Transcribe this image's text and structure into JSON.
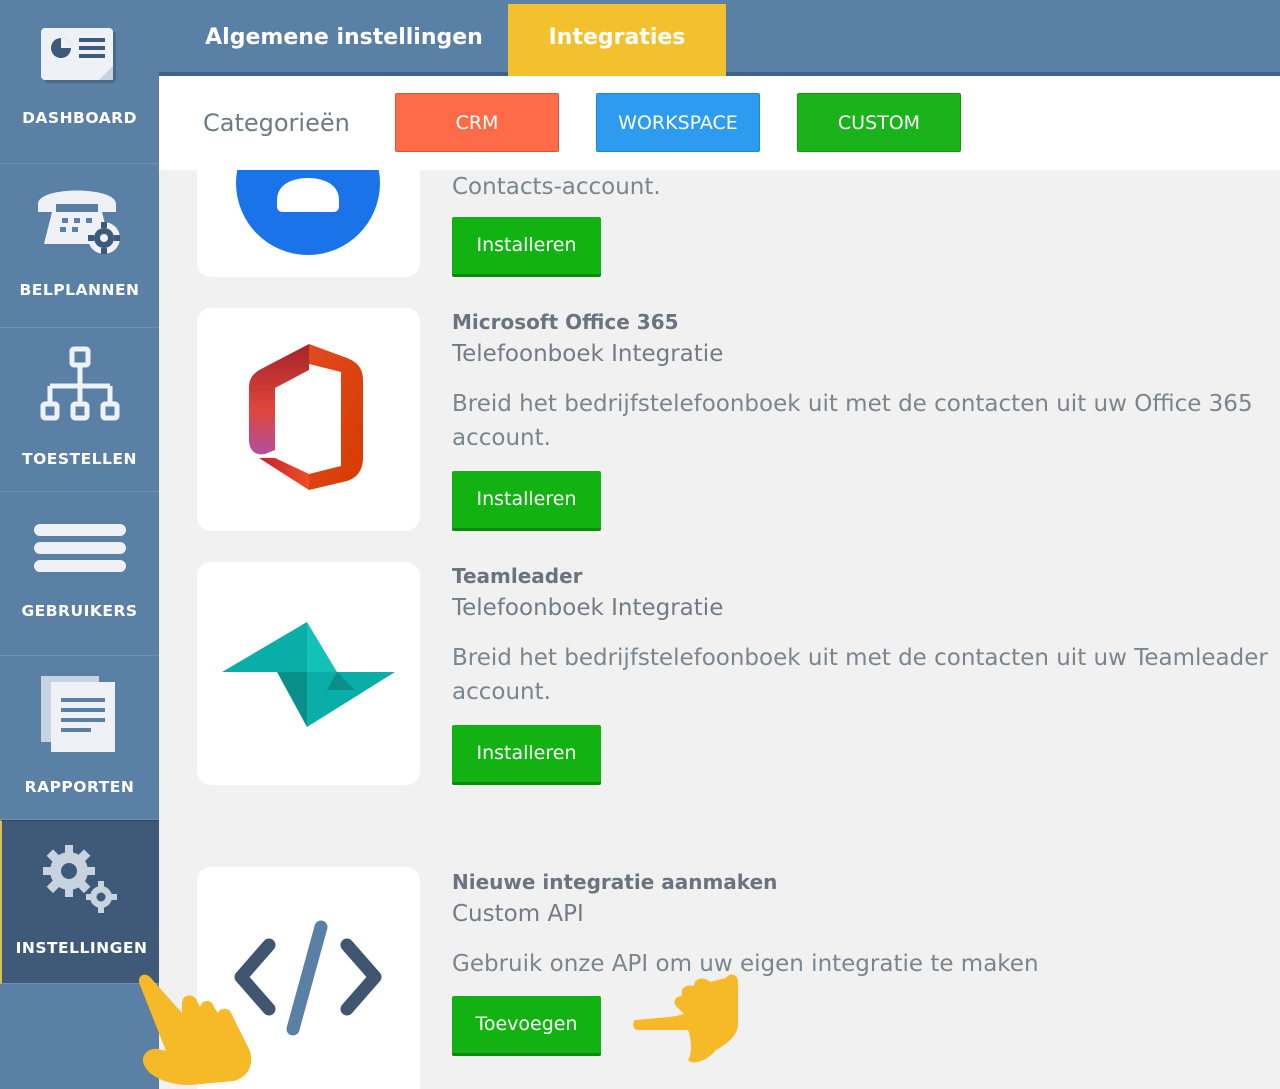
{
  "sidebar": {
    "items": [
      {
        "label": "DASHBOARD",
        "icon": "dashboard-icon"
      },
      {
        "label": "BELPLANNEN",
        "icon": "phone-gear-icon"
      },
      {
        "label": "TOESTELLEN",
        "icon": "org-chart-icon"
      },
      {
        "label": "GEBRUIKERS",
        "icon": "list-lines-icon"
      },
      {
        "label": "RAPPORTEN",
        "icon": "documents-icon"
      },
      {
        "label": "INSTELLINGEN",
        "icon": "gears-icon",
        "active": true
      }
    ]
  },
  "tabs": {
    "general": "Algemene instellingen",
    "integrations": "Integraties"
  },
  "categories": {
    "label": "Categorieën",
    "crm": "CRM",
    "workspace": "WORKSPACE",
    "custom": "CUSTOM"
  },
  "integrations": [
    {
      "description_tail": "Contacts-account.",
      "button": "Installeren",
      "icon": "google-contacts-icon"
    },
    {
      "title": "Microsoft Office 365",
      "subtitle": "Telefoonboek Integratie",
      "description": "Breid het bedrijfstelefoonboek uit met de contacten uit uw Office 365 account.",
      "button": "Installeren",
      "icon": "office-365-icon"
    },
    {
      "title": "Teamleader",
      "subtitle": "Telefoonboek Integratie",
      "description": "Breid het bedrijfstelefoonboek uit met de contacten uit uw Teamleader account.",
      "button": "Installeren",
      "icon": "teamleader-icon"
    },
    {
      "title": "Nieuwe integratie aanmaken",
      "subtitle": "Custom API",
      "description": "Gebruik onze API om uw eigen integratie te maken",
      "button": "Toevoegen",
      "icon": "code-icon"
    }
  ],
  "colors": {
    "sidebar": "#5b80a6",
    "active_tab": "#f3c02e",
    "crm": "#fe6b49",
    "workspace": "#2d9cf0",
    "custom": "#1bb31b",
    "install_button": "#12b212"
  }
}
